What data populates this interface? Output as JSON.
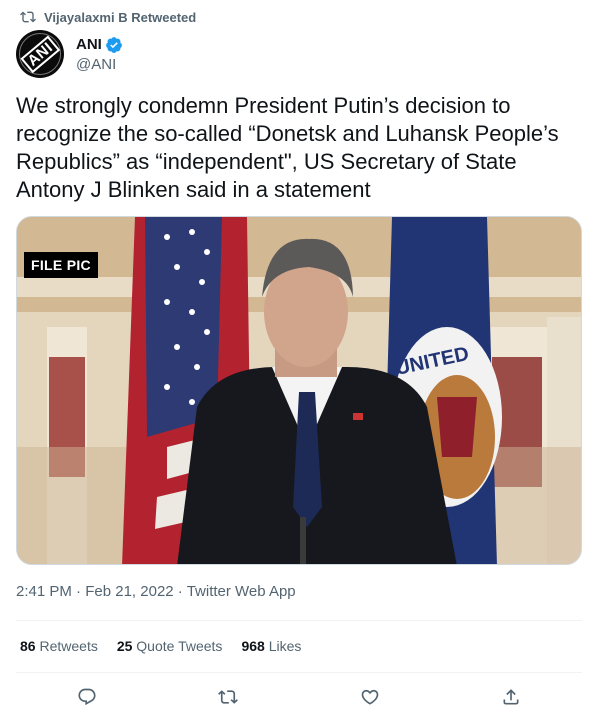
{
  "social_context": {
    "text": "Vijayalaxmi B Retweeted",
    "icon": "retweet-icon"
  },
  "author": {
    "display_name": "ANI",
    "handle": "@ANI",
    "verified": true,
    "avatar_text": "ANI"
  },
  "tweet": {
    "text": "We strongly condemn President Putin’s decision to recognize the so-called “Donetsk and Luhansk People’s Republics” as “independent\", US Secretary of State Antony J Blinken said in a statement"
  },
  "media": {
    "badge": "FILE PIC",
    "flag_text": "UNITED"
  },
  "meta": {
    "time": "2:41 PM",
    "sep1": " · ",
    "date": "Feb 21, 2022",
    "sep2": " · ",
    "app": "Twitter Web App"
  },
  "stats": [
    {
      "count": "86",
      "label": "Retweets"
    },
    {
      "count": "25",
      "label": "Quote Tweets"
    },
    {
      "count": "968",
      "label": "Likes"
    }
  ],
  "actions": [
    "reply-icon",
    "retweet-icon",
    "like-icon",
    "share-icon"
  ],
  "colors": {
    "text": "#0f1419",
    "secondary": "#536471",
    "verified": "#1d9bf0",
    "divider": "#eff3f4"
  }
}
